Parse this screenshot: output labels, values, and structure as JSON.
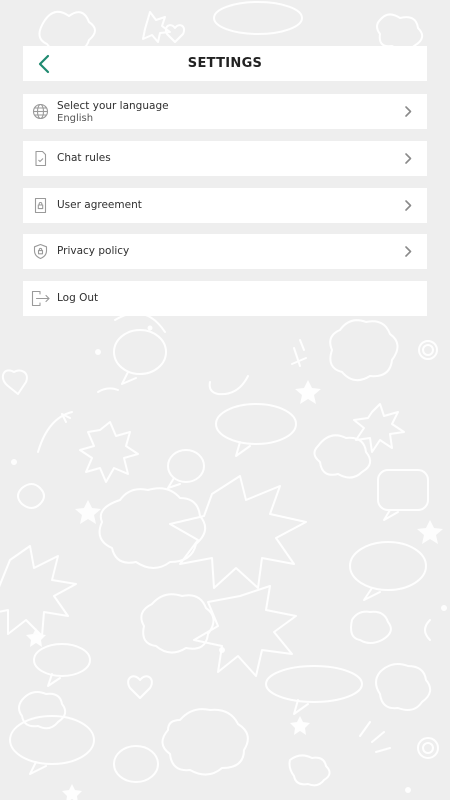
{
  "header": {
    "title": "SETTINGS",
    "back_icon": "chevron-left-icon",
    "accent_color": "#1f8a70"
  },
  "settings": {
    "language": {
      "label": "Select your language",
      "value": "English",
      "icon": "globe-icon"
    },
    "chat_rules": {
      "label": "Chat rules",
      "icon": "document-check-icon"
    },
    "user_agreement": {
      "label": "User agreement",
      "icon": "document-lock-icon"
    },
    "privacy_policy": {
      "label": "Privacy policy",
      "icon": "shield-lock-icon"
    },
    "log_out": {
      "label": "Log Out",
      "icon": "logout-icon"
    }
  },
  "colors": {
    "background": "#eeeeee",
    "card": "#ffffff",
    "icon_gray": "#9a9a9a",
    "chevron_gray": "#8a8a8a"
  }
}
